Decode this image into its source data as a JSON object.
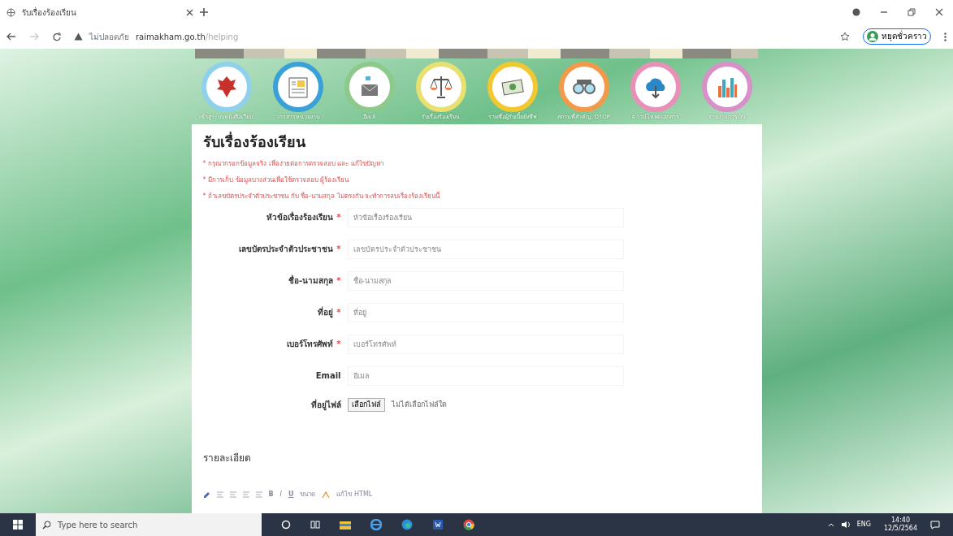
{
  "browser": {
    "tab_title": "รับเรื่องร้องเรียน",
    "security": "ไม่ปลอดภัย",
    "url_host": "raimakham.go.th",
    "url_path": "/helping",
    "profile": "หยุดชั่วคราว"
  },
  "menu": [
    {
      "label": "เข้าสู่ระบบหนังสือเวียน"
    },
    {
      "label": "วารสารหน่วยงาน"
    },
    {
      "label": "อีเมล์"
    },
    {
      "label": "รับเรื่องร้องเรียน"
    },
    {
      "label": "รายชื่อผู้รับเบี้ยยังชีพ"
    },
    {
      "label": "สถานที่สำคัญ, OTOP"
    },
    {
      "label": "ดาวน์โหลดเอกสาร"
    },
    {
      "label": "รายงานการเงิน"
    }
  ],
  "form": {
    "title": "รับเรื่องร้องเรียน",
    "notes": [
      "* กรุณากรอกข้อมูลจริง เพื่อง่ายต่อการตรวจสอบ และ แก้ไขปัญหา",
      "* มีการเก็บ ข้อมูลบางส่วนเพื่อใช้ตรวจสอบ ผู้ร้องเรียน",
      "* ถ้าเลขบัตรประจำตัวประชาชน กับ ชื่อ-นามสกุล ไม่ตรงกัน จะทำการลบเรื่องร้องเรียนนี้"
    ],
    "fields": [
      {
        "kind": "text",
        "label": "หัวข้อเรื่องร้องเรียน",
        "required_mark": "*",
        "placeholder": "หัวข้อเรื่องร้องเรียน"
      },
      {
        "kind": "text",
        "label": "เลขบัตรประจำตัวประชาชน",
        "required_mark": "*",
        "placeholder": "เลขบัตรประจำตัวประชาชน"
      },
      {
        "kind": "text",
        "label": "ชื่อ-นามสกุล",
        "required_mark": "*",
        "placeholder": "ชื่อ-นามสกุล"
      },
      {
        "kind": "text",
        "label": "ที่อยู่",
        "required_mark": "*",
        "placeholder": "ที่อยู่"
      },
      {
        "kind": "text",
        "label": "เบอร์โทรศัพท์",
        "required_mark": "*",
        "placeholder": "เบอร์โทรศัพท์"
      },
      {
        "kind": "text",
        "label": "Email",
        "placeholder": "อีเมล"
      },
      {
        "kind": "file",
        "label": "ที่อยู่ไฟล์",
        "button": "เลือกไฟล์",
        "status": "ไม่ได้เลือกไฟล์ใด"
      }
    ],
    "details_label": "รายละเอียด",
    "editor_toolbar": {
      "bold": "B",
      "italic": "I",
      "underline": "U",
      "size": "ขนาด",
      "html": "แก้ไข HTML"
    }
  },
  "taskbar": {
    "search_placeholder": "Type here to search",
    "language": "ENG",
    "time": "14:40",
    "date": "12/5/2564"
  }
}
